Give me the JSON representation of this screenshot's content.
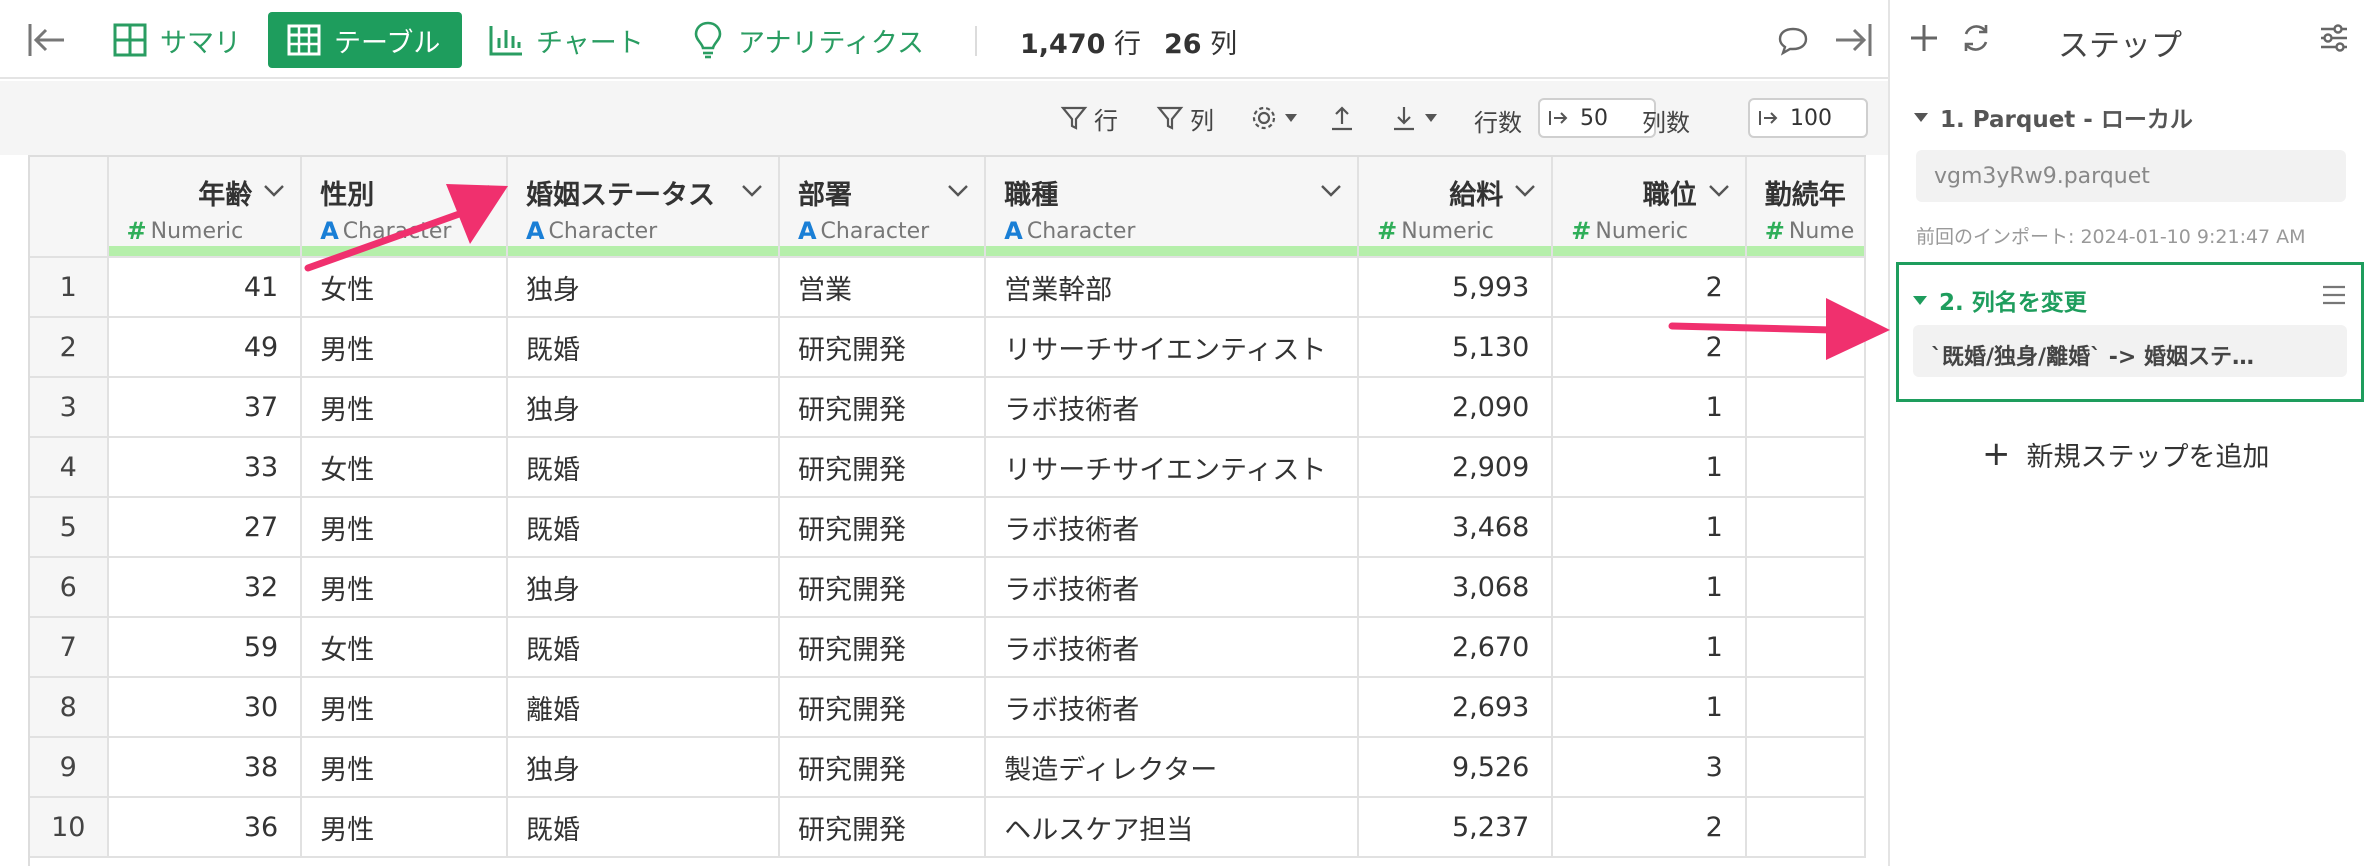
{
  "tabs": [
    {
      "label": "サマリ",
      "icon": "summary-grid-icon"
    },
    {
      "label": "テーブル",
      "icon": "table-icon",
      "active": true
    },
    {
      "label": "チャート",
      "icon": "bar-chart-icon"
    },
    {
      "label": "アナリティクス",
      "icon": "lightbulb-icon"
    }
  ],
  "counts": {
    "rows": "1,470",
    "rows_unit": "行",
    "cols": "26",
    "cols_unit": "列"
  },
  "toolbar": {
    "row_filter": "行",
    "col_filter": "列",
    "rows_label": "行数",
    "rows_value": "50",
    "cols_label": "列数",
    "cols_value": "100"
  },
  "columns": [
    {
      "name": "年齢",
      "type": "Numeric",
      "kind": "num"
    },
    {
      "name": "性別",
      "type": "Character",
      "kind": "chr"
    },
    {
      "name": "婚姻ステータス",
      "type": "Character",
      "kind": "chr"
    },
    {
      "name": "部署",
      "type": "Character",
      "kind": "chr"
    },
    {
      "name": "職種",
      "type": "Character",
      "kind": "chr"
    },
    {
      "name": "給料",
      "type": "Numeric",
      "kind": "num"
    },
    {
      "name": "職位",
      "type": "Numeric",
      "kind": "num"
    },
    {
      "name": "勤続年",
      "type": "Nume",
      "kind": "num"
    }
  ],
  "rows": [
    [
      "1",
      "41",
      "女性",
      "独身",
      "営業",
      "営業幹部",
      "5,993",
      "2",
      ""
    ],
    [
      "2",
      "49",
      "男性",
      "既婚",
      "研究開発",
      "リサーチサイエンティスト",
      "5,130",
      "2",
      ""
    ],
    [
      "3",
      "37",
      "男性",
      "独身",
      "研究開発",
      "ラボ技術者",
      "2,090",
      "1",
      ""
    ],
    [
      "4",
      "33",
      "女性",
      "既婚",
      "研究開発",
      "リサーチサイエンティスト",
      "2,909",
      "1",
      ""
    ],
    [
      "5",
      "27",
      "男性",
      "既婚",
      "研究開発",
      "ラボ技術者",
      "3,468",
      "1",
      ""
    ],
    [
      "6",
      "32",
      "男性",
      "独身",
      "研究開発",
      "ラボ技術者",
      "3,068",
      "1",
      ""
    ],
    [
      "7",
      "59",
      "女性",
      "既婚",
      "研究開発",
      "ラボ技術者",
      "2,670",
      "1",
      ""
    ],
    [
      "8",
      "30",
      "男性",
      "離婚",
      "研究開発",
      "ラボ技術者",
      "2,693",
      "1",
      ""
    ],
    [
      "9",
      "38",
      "男性",
      "独身",
      "研究開発",
      "製造ディレクター",
      "9,526",
      "3",
      ""
    ],
    [
      "10",
      "36",
      "男性",
      "既婚",
      "研究開発",
      "ヘルスケア担当",
      "5,237",
      "2",
      ""
    ]
  ],
  "panel": {
    "title": "ステップ",
    "step1": {
      "title": "1. Parquet - ローカル",
      "file": "vgm3yRw9.parquet",
      "meta": "前回のインポート: 2024-01-10 9:21:47 AM"
    },
    "step2": {
      "title": "2. 列名を変更",
      "detail": "`既婚/独身/離婚` -> 婚姻ステ…"
    },
    "add_step": "新規ステップを追加"
  },
  "colors": {
    "accent": "#1e9d5d",
    "type_bar": "#b5efaa",
    "arrow": "#f0306e"
  }
}
